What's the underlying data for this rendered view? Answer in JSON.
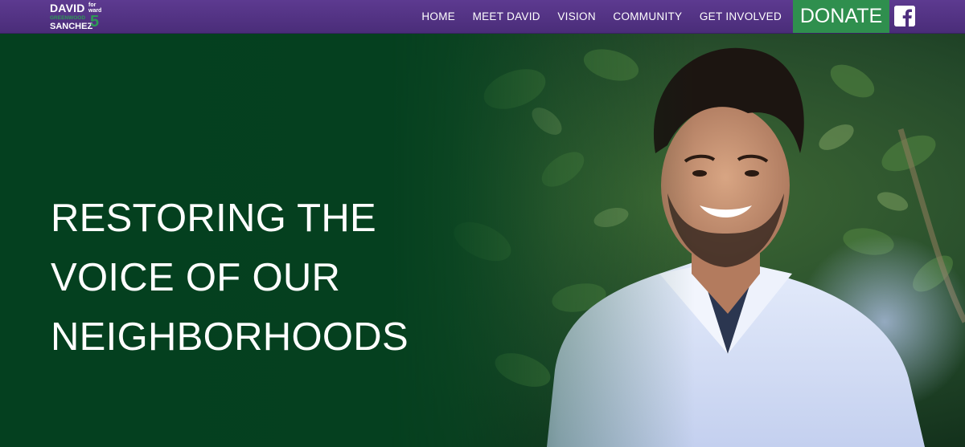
{
  "logo": {
    "line1": "DAVID",
    "for": "for",
    "ward": "ward",
    "district": "GREENWOOD",
    "name": "SANCHEZ",
    "number": "5"
  },
  "nav": {
    "items": [
      {
        "label": "HOME"
      },
      {
        "label": "MEET DAVID"
      },
      {
        "label": "VISION"
      },
      {
        "label": "COMMUNITY"
      },
      {
        "label": "GET INVOLVED"
      }
    ],
    "donate_label": "DONATE",
    "social_icon": "facebook-icon"
  },
  "hero": {
    "headline_lines": [
      "RESTORING THE",
      "VOICE OF OUR",
      "NEIGHBORHOODS"
    ]
  },
  "colors": {
    "nav_purple": "#4f2f7f",
    "donate_green": "#2f8f4e",
    "hero_green": "#05401f",
    "text": "#ffffff"
  }
}
